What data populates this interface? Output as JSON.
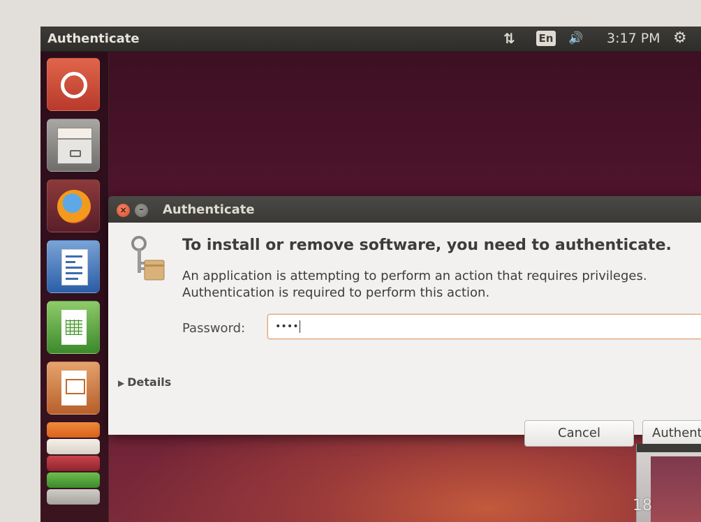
{
  "topbar": {
    "title": "Authenticate",
    "network_icon": "network-updown-icon",
    "language": "En",
    "volume_icon": "volume-icon",
    "clock": "3:17 PM",
    "settings_icon": "gear-icon"
  },
  "launcher": {
    "items": [
      {
        "name": "ubuntu-dash",
        "icon": "ubuntu-logo-icon"
      },
      {
        "name": "files",
        "icon": "file-cabinet-icon"
      },
      {
        "name": "firefox",
        "icon": "firefox-icon"
      },
      {
        "name": "libreoffice-writer",
        "icon": "writer-icon"
      },
      {
        "name": "libreoffice-calc",
        "icon": "calc-icon"
      },
      {
        "name": "libreoffice-impress",
        "icon": "impress-icon"
      },
      {
        "name": "software-center",
        "icon": "software-center-icon"
      },
      {
        "name": "amazon",
        "icon": "amazon-icon"
      }
    ]
  },
  "dialog": {
    "title": "Authenticate",
    "heading": "To install or remove software, you need to authenticate.",
    "description_line1": "An application is attempting to perform an action that requires privileges.",
    "description_line2": "Authentication is required to perform this action.",
    "password_label": "Password:",
    "password_value": "••••",
    "details_label": "Details",
    "cancel_label": "Cancel",
    "authenticate_label": "Authenticate"
  },
  "overlay": {
    "page_number": "18"
  },
  "colors": {
    "accent": "#dd4814",
    "panel": "#3c3b37",
    "dialog_bg": "#f2f1f0"
  }
}
